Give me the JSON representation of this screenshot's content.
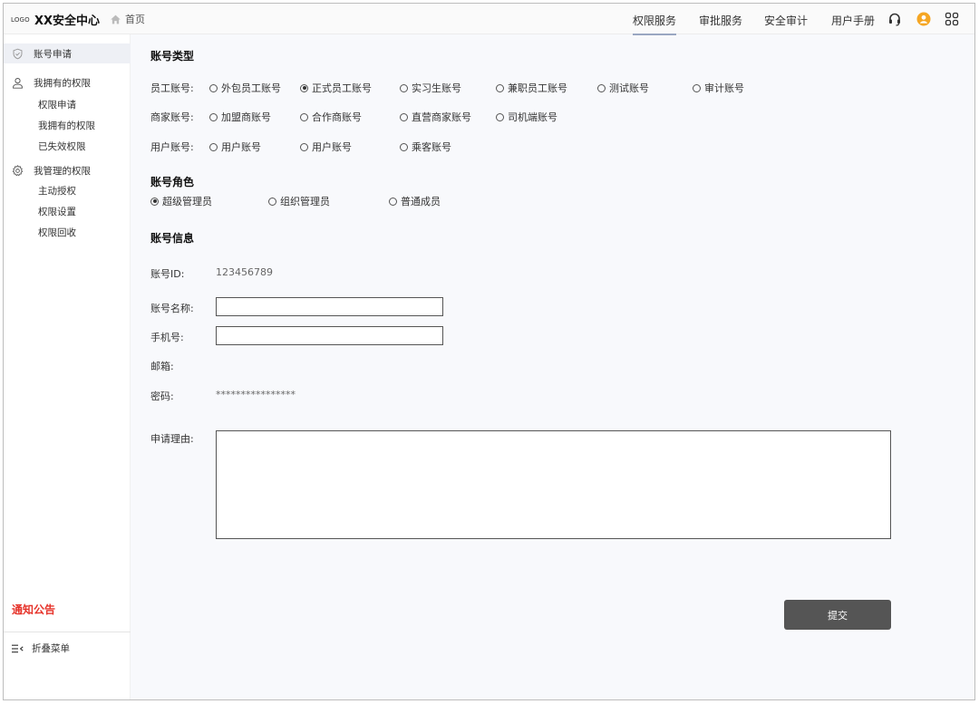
{
  "topbar": {
    "logo": "LOGO",
    "title": "XX安全中心",
    "home_label": "首页",
    "nav": [
      "权限服务",
      "审批服务",
      "安全审计",
      "用户手册"
    ],
    "active_nav": "权限服务"
  },
  "sidebar": {
    "apply": "账号申请",
    "my_perms": "我拥有的权限",
    "my_perms_items": [
      "权限申请",
      "我拥有的权限",
      "已失效权限"
    ],
    "managed": "我管理的权限",
    "managed_items": [
      "主动授权",
      "权限设置",
      "权限回收"
    ],
    "notice": "通知公告",
    "collapse": "折叠菜单"
  },
  "account_type": {
    "title": "账号类型",
    "employee_label": "员工账号:",
    "employee_options": [
      "外包员工账号",
      "正式员工账号",
      "实习生账号",
      "兼职员工账号",
      "测试账号",
      "审计账号"
    ],
    "employee_selected": "正式员工账号",
    "merchant_label": "商家账号:",
    "merchant_options": [
      "加盟商账号",
      "合作商账号",
      "直营商家账号",
      "司机端账号"
    ],
    "user_label": "用户账号:",
    "user_options": [
      "用户账号",
      "用户账号",
      "乘客账号"
    ]
  },
  "account_role": {
    "title": "账号角色",
    "options": [
      "超级管理员",
      "组织管理员",
      "普通成员"
    ],
    "selected": "超级管理员"
  },
  "account_info": {
    "title": "账号信息",
    "id_label": "账号ID:",
    "id_value": "123456789",
    "name_label": "账号名称:",
    "name_value": "",
    "phone_label": "手机号:",
    "phone_value": "",
    "email_label": "邮箱:",
    "password_label": "密码:",
    "password_value": "****************",
    "reason_label": "申请理由:",
    "reason_value": ""
  },
  "submit_label": "提交",
  "colors": {
    "notice": "#e6332a",
    "avatar": "#f5a623",
    "button": "#555555"
  }
}
